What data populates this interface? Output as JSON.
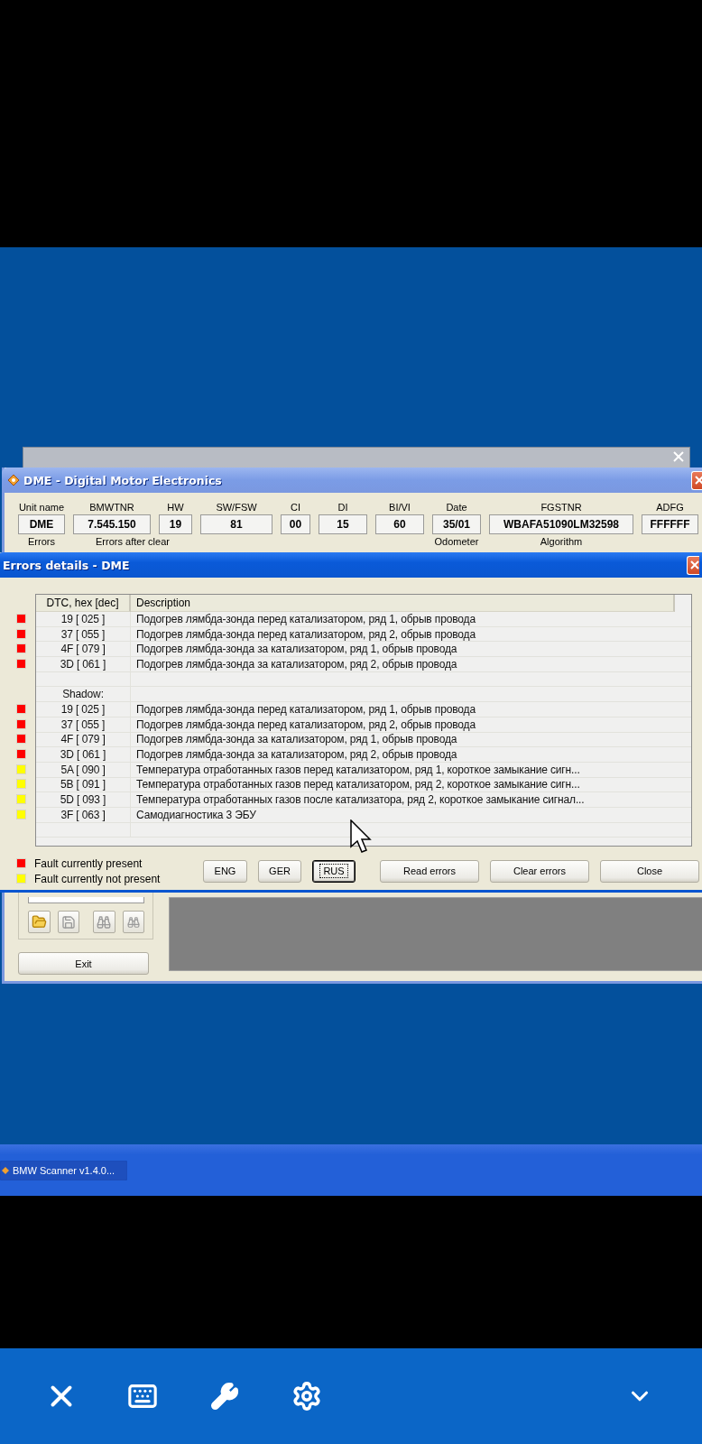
{
  "main_window": {
    "title": "DME - Digital Motor Electronics",
    "info_fields": [
      {
        "label": "Unit name",
        "value": "DME"
      },
      {
        "label": "BMWTNR",
        "value": "7.545.150"
      },
      {
        "label": "HW",
        "value": "19"
      },
      {
        "label": "SW/FSW",
        "value": "81"
      },
      {
        "label": "CI",
        "value": "00"
      },
      {
        "label": "DI",
        "value": "15"
      },
      {
        "label": "BI/VI",
        "value": "60"
      },
      {
        "label": "Date",
        "value": "35/01"
      },
      {
        "label": "FGSTNR",
        "value": "WBAFA51090LM32598"
      },
      {
        "label": "ADFG",
        "value": "FFFFFF"
      }
    ],
    "sub_labels": [
      "Errors",
      "Errors after clear",
      "Odometer",
      "Algorithm"
    ],
    "tool_buttons": [
      {
        "kind": "open",
        "disabled": false
      },
      {
        "kind": "save",
        "disabled": true
      },
      {
        "kind": "find",
        "disabled": true
      },
      {
        "kind": "find_next",
        "disabled": true
      }
    ],
    "exit_button": "Exit"
  },
  "errors_dialog": {
    "title": "Errors details - DME",
    "columns": [
      "DTC, hex [dec]",
      "Description"
    ],
    "rows": [
      {
        "kind": "fault",
        "color": "#ff0000",
        "code": "19 [ 025 ]",
        "description": "Подогрев лямбда-зонда перед катализатором, ряд 1, обрыв провода"
      },
      {
        "kind": "fault",
        "color": "#ff0000",
        "code": "37 [ 055 ]",
        "description": "Подогрев лямбда-зонда перед катализатором, ряд 2, обрыв провода"
      },
      {
        "kind": "fault",
        "color": "#ff0000",
        "code": "4F [ 079 ]",
        "description": "Подогрев лямбда-зонда за катализатором, ряд 1, обрыв провода"
      },
      {
        "kind": "fault",
        "color": "#ff0000",
        "code": "3D [ 061 ]",
        "description": "Подогрев лямбда-зонда за катализатором, ряд 2, обрыв провода"
      },
      {
        "kind": "blank"
      },
      {
        "kind": "group",
        "code": "Shadow:"
      },
      {
        "kind": "fault",
        "color": "#ff0000",
        "code": "19 [ 025 ]",
        "description": "Подогрев лямбда-зонда перед катализатором, ряд 1, обрыв провода"
      },
      {
        "kind": "fault",
        "color": "#ff0000",
        "code": "37 [ 055 ]",
        "description": "Подогрев лямбда-зонда перед катализатором, ряд 2, обрыв провода"
      },
      {
        "kind": "fault",
        "color": "#ff0000",
        "code": "4F [ 079 ]",
        "description": "Подогрев лямбда-зонда за катализатором, ряд 1, обрыв провода"
      },
      {
        "kind": "fault",
        "color": "#ff0000",
        "code": "3D [ 061 ]",
        "description": "Подогрев лямбда-зонда за катализатором, ряд 2, обрыв провода"
      },
      {
        "kind": "fault",
        "color": "#ffff00",
        "code": "5A [ 090 ]",
        "description": "Температура отработанных газов перед катализатором, ряд 1, короткое замыкание сигн..."
      },
      {
        "kind": "fault",
        "color": "#ffff00",
        "code": "5B [ 091 ]",
        "description": "Температура отработанных газов перед катализатором, ряд 2, короткое замыкание сигн..."
      },
      {
        "kind": "fault",
        "color": "#ffff00",
        "code": "5D [ 093 ]",
        "description": "Температура отработанных газов после катализатора, ряд 2, короткое замыкание сигнал..."
      },
      {
        "kind": "fault",
        "color": "#ffff00",
        "code": "3F [ 063 ]",
        "description": "Самодиагностика 3 ЭБУ"
      }
    ],
    "legend": [
      {
        "color": "#ff0000",
        "label": "Fault currently present"
      },
      {
        "color": "#ffff00",
        "label": "Fault currently not present"
      }
    ],
    "language_buttons": [
      {
        "label": "ENG",
        "selected": false
      },
      {
        "label": "GER",
        "selected": false
      },
      {
        "label": "RUS",
        "selected": true
      }
    ],
    "action_buttons": [
      "Read errors",
      "Clear errors",
      "Close"
    ]
  },
  "taskbar": {
    "items": [
      "BMW Scanner v1.4.0..."
    ]
  }
}
